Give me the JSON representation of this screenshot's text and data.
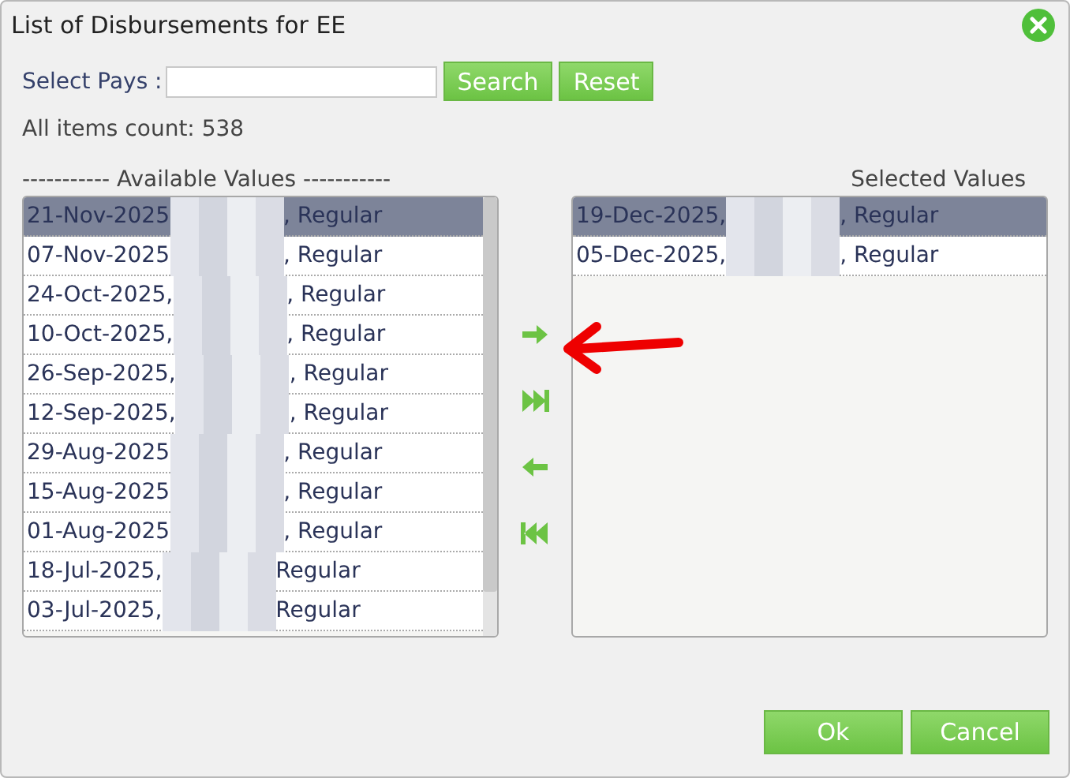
{
  "window": {
    "title": "List of Disbursements for EE"
  },
  "search": {
    "label": "Select Pays :"
  },
  "buttons_top": [
    "Search",
    "Reset"
  ],
  "count": "All items count: 538",
  "available": {
    "heading": "----------- Available Values -----------",
    "items": [
      {
        "before": "21-Nov-2025",
        "after": ", Regular",
        "selected": true
      },
      {
        "before": "07-Nov-2025",
        "after": ", Regular",
        "selected": false
      },
      {
        "before": "24-Oct-2025,",
        "after": ", Regular",
        "selected": false
      },
      {
        "before": "10-Oct-2025,",
        "after": ", Regular",
        "selected": false
      },
      {
        "before": "26-Sep-2025,",
        "after": ", Regular",
        "selected": false
      },
      {
        "before": "12-Sep-2025,",
        "after": ", Regular",
        "selected": false
      },
      {
        "before": "29-Aug-2025",
        "after": ", Regular",
        "selected": false
      },
      {
        "before": "15-Aug-2025",
        "after": ", Regular",
        "selected": false
      },
      {
        "before": "01-Aug-2025",
        "after": ", Regular",
        "selected": false
      },
      {
        "before": "18-Jul-2025,",
        "after": "Regular",
        "selected": false
      },
      {
        "before": "03-Jul-2025,",
        "after": "Regular",
        "selected": false
      }
    ]
  },
  "selected": {
    "heading": "Selected Values",
    "items": [
      {
        "before": "19-Dec-2025,",
        "after": ", Regular",
        "selected": true
      },
      {
        "before": "05-Dec-2025,",
        "after": ", Regular",
        "selected": false
      }
    ]
  },
  "buttons_bottom": [
    "Ok",
    "Cancel"
  ]
}
